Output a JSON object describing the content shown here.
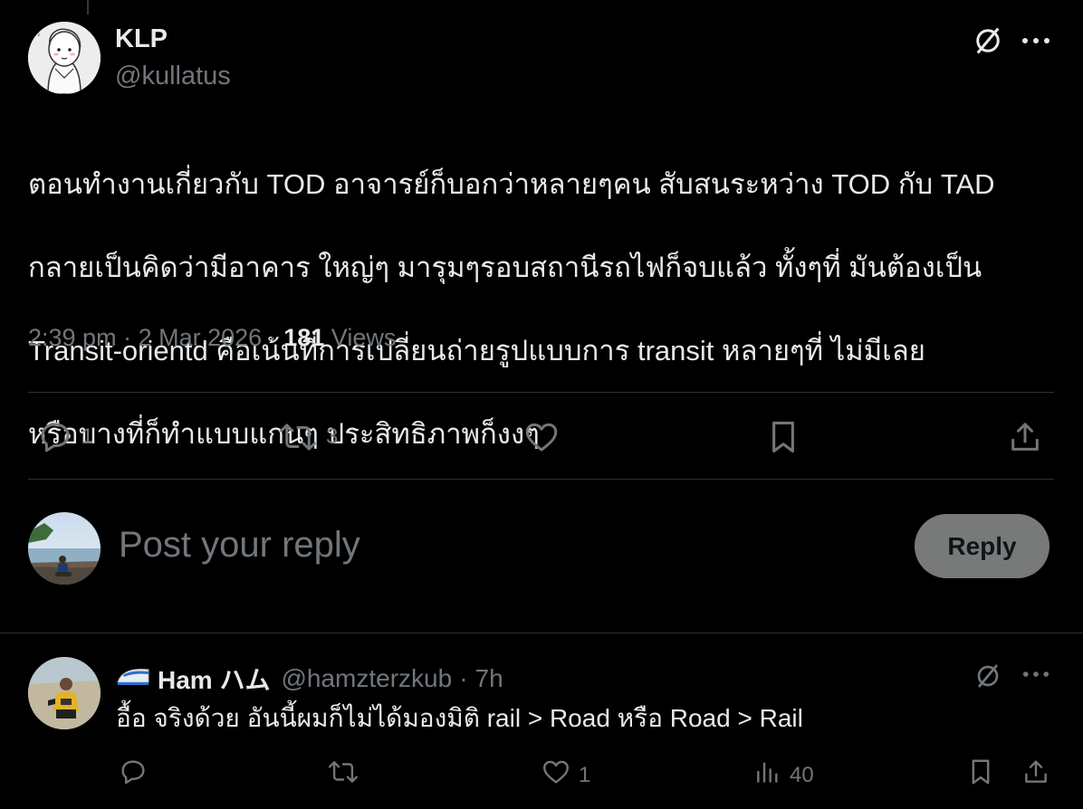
{
  "tweet": {
    "author_name": "KLP",
    "author_handle": "@kullatus",
    "text_lines": [
      "ตอนทำงานเกี่ยวกับ TOD อาจารย์ก็บอกว่าหลายๆคน สับสนระหว่าง TOD กับ TAD",
      "กลายเป็นคิดว่ามีอาคาร ใหญ่ๆ มารุมๆรอบสถานีรถไฟก็จบแล้ว ทั้งๆที่ มันต้องเป็น",
      "Transit-orientd คือเน้นที่การเปลี่ยนถ่ายรูปแบบการ transit หลายๆที่ ไม่มีเลย",
      "หรือบางที่ก็ทำแบบแกนๆ ประสิทธิภาพก็งงๆ"
    ],
    "time": "2:39 pm",
    "date": "2 Mar 2026",
    "separator": "·",
    "views_count": "181",
    "views_label": "Views",
    "replies": "1",
    "reposts": "3"
  },
  "composer": {
    "placeholder": "Post your reply",
    "reply_button": "Reply"
  },
  "reply": {
    "name": "Ham ハム",
    "handle": "@hamzterzkub",
    "separator": "·",
    "time": "7h",
    "text": "อื้อ จริงด้วย อันนี้ผมก็ไม่ได้มองมิติ rail > Road หรือ Road > Rail",
    "likes": "1",
    "views": "40"
  },
  "icons": {
    "grok": "grok-icon",
    "more": "more-icon",
    "reply": "reply-icon",
    "repost": "repost-icon",
    "like": "like-icon",
    "bookmark": "bookmark-icon",
    "share": "share-icon",
    "views": "views-icon",
    "train": "train-emoji-icon"
  },
  "colors": {
    "background": "#000000",
    "text": "#e7e9ea",
    "muted": "#71767b",
    "divider": "#2f3336",
    "reply_button_bg": "#787a7a"
  }
}
